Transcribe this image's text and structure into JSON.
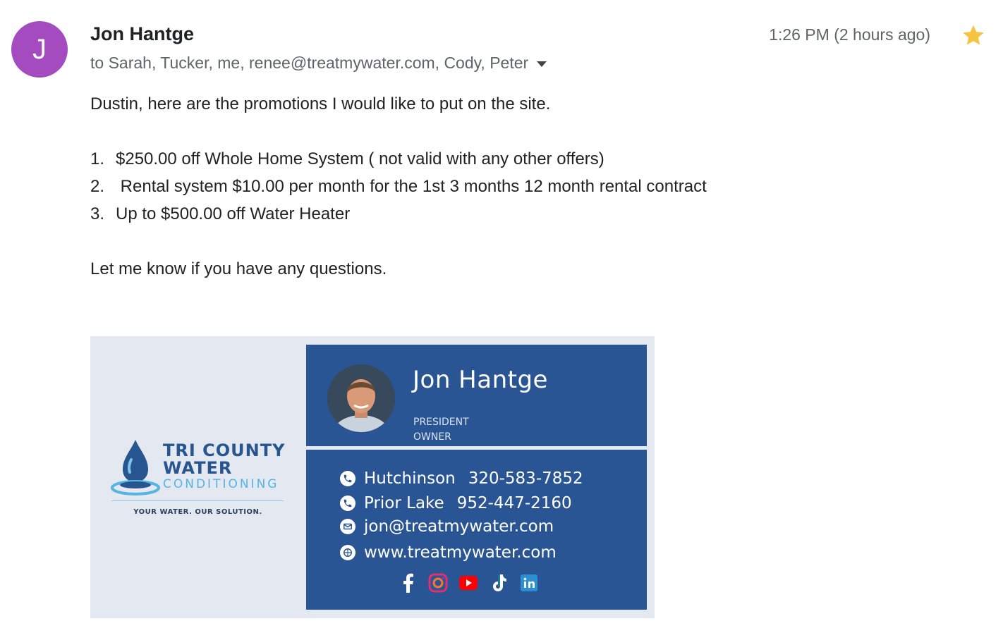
{
  "sender": {
    "initial": "J",
    "name": "Jon Hantge",
    "recipients": "to Sarah, Tucker, me, renee@treatmywater.com, Cody, Peter",
    "timestamp": "1:26 PM (2 hours ago)",
    "avatar_color": "#a44bc0",
    "starred": true,
    "star_color": "#f5c542"
  },
  "body": {
    "intro": "Dustin, here are the promotions I would like to put on the site.",
    "promotions": [
      {
        "num": "1.",
        "text": "$250.00 off Whole Home System ( not valid with any other offers)"
      },
      {
        "num": "2.",
        "text": " Rental system $10.00 per month for the 1st 3 months 12 month rental contract"
      },
      {
        "num": "3.",
        "text": "Up to $500.00 off Water Heater"
      }
    ],
    "closing": "Let me know if you have any questions."
  },
  "signature": {
    "logo": {
      "line1": "TRI COUNTY",
      "line2": "WATER",
      "line3": "CONDITIONING",
      "tagline": "YOUR WATER. OUR SOLUTION."
    },
    "name": "Jon Hantge",
    "title1": "PRESIDENT",
    "title2": "OWNER",
    "contacts": [
      {
        "icon": "phone-icon",
        "label": "Hutchinson",
        "value": "320-583-7852"
      },
      {
        "icon": "phone-icon",
        "label": "Prior Lake",
        "value": "952-447-2160"
      },
      {
        "icon": "email-icon",
        "label": "",
        "value": "jon@treatmywater.com"
      },
      {
        "icon": "globe-icon",
        "label": "",
        "value": "www.treatmywater.com"
      }
    ],
    "socials": [
      "facebook-icon",
      "instagram-icon",
      "youtube-icon",
      "tiktok-icon",
      "linkedin-icon"
    ],
    "colors": {
      "panel": "#2a5594",
      "background": "#e3e8f1",
      "brand_dark": "#27558f",
      "brand_light": "#56b4e3"
    }
  }
}
